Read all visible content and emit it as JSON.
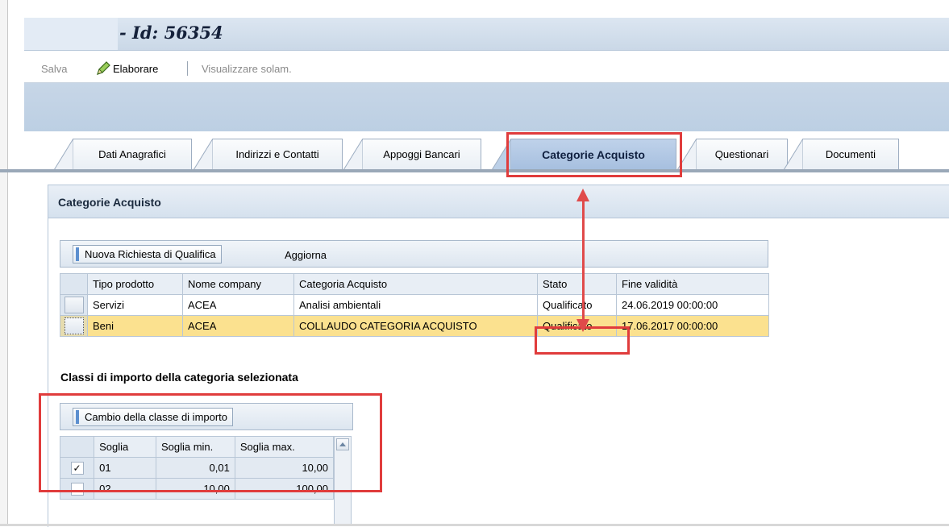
{
  "window": {
    "title": "- Id: 56354"
  },
  "toolbar": {
    "save_label": "Salva",
    "edit_label": "Elaborare",
    "view_only_label": "Visualizzare solam."
  },
  "tabs": [
    {
      "label": "Dati Anagrafici"
    },
    {
      "label": "Indirizzi e Contatti"
    },
    {
      "label": "Appoggi Bancari"
    },
    {
      "label": "Categorie Acquisto",
      "active": true
    },
    {
      "label": "Questionari"
    },
    {
      "label": "Documenti"
    }
  ],
  "panel": {
    "title": "Categorie Acquisto"
  },
  "categories_grid": {
    "new_request_label": "Nuova Richiesta di Qualifica",
    "refresh_label": "Aggiorna",
    "columns": [
      "Tipo prodotto",
      "Nome company",
      "Categoria Acquisto",
      "Stato",
      "Fine validità"
    ],
    "rows": [
      {
        "tipo": "Servizi",
        "company": "ACEA",
        "categoria": "Analisi ambientali",
        "stato": "Qualificato",
        "fine": "24.06.2019 00:00:00",
        "selected": false
      },
      {
        "tipo": "Beni",
        "company": "ACEA",
        "categoria": "COLLAUDO CATEGORIA ACQUISTO",
        "stato": "Qualificato",
        "fine": "17.06.2017 00:00:00",
        "selected": true
      }
    ]
  },
  "amount_section": {
    "title": "Classi di importo della categoria selezionata",
    "change_button_label": "Cambio della classe di importo",
    "columns": [
      "Soglia",
      "Soglia min.",
      "Soglia max."
    ],
    "rows": [
      {
        "soglia": "01",
        "min": "0,01",
        "max": "10,00",
        "checked": true
      },
      {
        "soglia": "02",
        "min": "10,00",
        "max": "100,00",
        "checked": false
      }
    ]
  },
  "colors": {
    "highlight_row": "#fbe18f",
    "annotation_red": "#e03c3c",
    "active_tab": "#a6bfdf"
  }
}
